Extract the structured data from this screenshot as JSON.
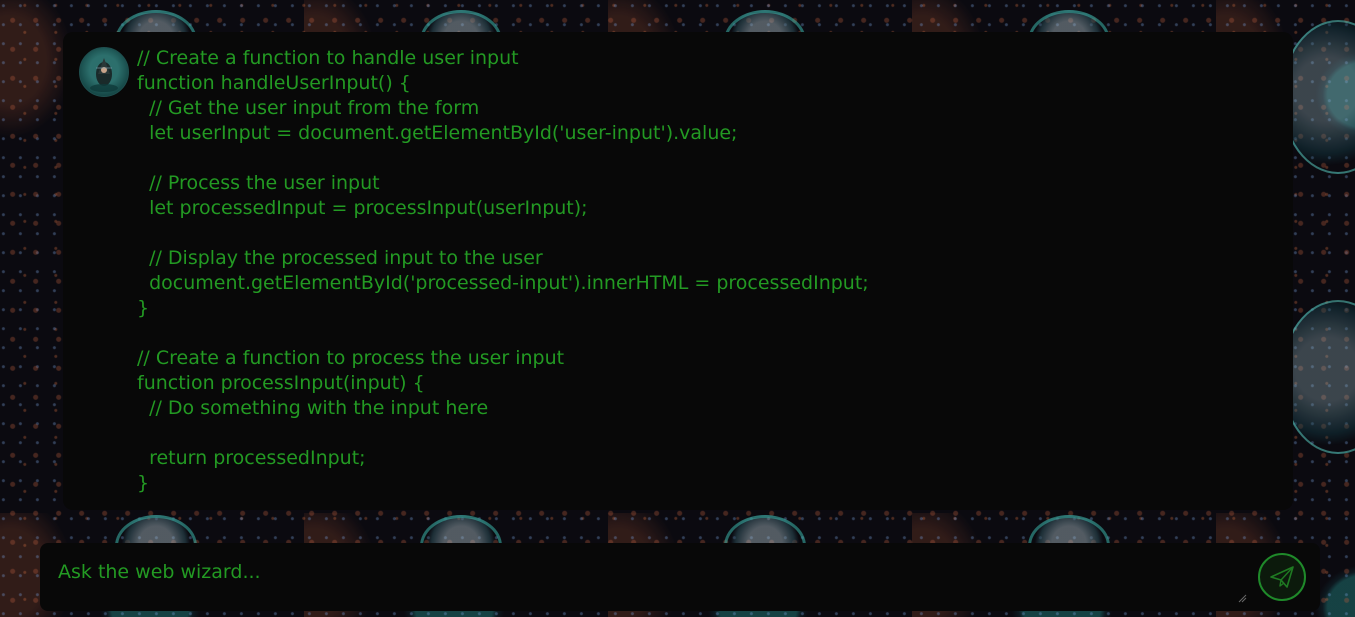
{
  "chat": {
    "message": {
      "lines": [
        "// Create a function to handle user input",
        "function handleUserInput() {",
        "  // Get the user input from the form",
        "  let userInput = document.getElementById('user-input').value;",
        "",
        "  // Process the user input",
        "  let processedInput = processInput(userInput);",
        "",
        "  // Display the processed input to the user",
        "  document.getElementById('processed-input').innerHTML = processedInput;",
        "}",
        "",
        "// Create a function to process the user input",
        "function processInput(input) {",
        "  // Do something with the input here",
        "",
        "  return processedInput;",
        "}"
      ]
    }
  },
  "composer": {
    "placeholder": "Ask the web wizard..."
  },
  "icons": {
    "avatar": "wizard-avatar",
    "send": "paper-plane-icon"
  },
  "colors": {
    "text_green": "#239a23",
    "panel_bg": "#080808",
    "send_ring": "#1f8a2a"
  }
}
